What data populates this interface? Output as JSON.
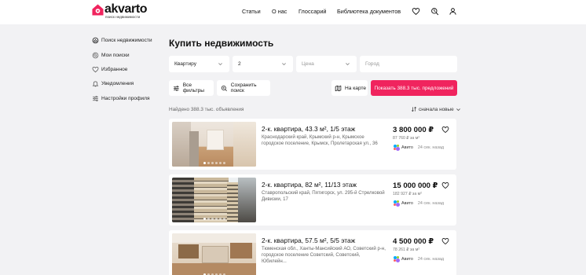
{
  "brand": {
    "name": "akvarto",
    "tagline": "поиск недвижимости",
    "accent": "#f0245e"
  },
  "nav": [
    "Статьи",
    "О нас",
    "Глоссарий",
    "Библиотека документов"
  ],
  "header_icons": [
    "heart-icon",
    "search-history-icon",
    "user-icon"
  ],
  "sidebar": [
    {
      "label": "Поиск недвижимости",
      "icon": "search-home-icon"
    },
    {
      "label": "Мои поиски",
      "icon": "search-icon"
    },
    {
      "label": "Избранное",
      "icon": "heart-icon"
    },
    {
      "label": "Уведомления",
      "icon": "bell-icon"
    },
    {
      "label": "Настройки профиля",
      "icon": "settings-icon"
    }
  ],
  "main": {
    "title": "Купить недвижимость",
    "filters": {
      "type": "Квартиру",
      "rooms": "2",
      "price_placeholder": "Цена",
      "city_placeholder": "Город"
    },
    "buttons": {
      "all_filters": "Все фильтры",
      "save_search": "Сохранить поиск",
      "on_map": "На карте",
      "show": "Показать 388.3 тыс. предложений"
    },
    "found": "Найдено 388.3 тыс. объявления",
    "sort": "сначала новые"
  },
  "listings": [
    {
      "title": "2-к. квартира, 43.3 м², 1/5 этаж",
      "address": "Краснодарский край, Крымский р-н, Крымское городское поселение, Крымск, Пролетарская ул., 36",
      "price": "3 800 000 ₽",
      "price_per_m2": "87 760 ₽ за м²",
      "source": "Авито",
      "ago": "24 сек. назад"
    },
    {
      "title": "2-к. квартира, 82 м², 11/13 этаж",
      "address": "Ставропольский край, Пятигорск, ул. 295-й Стрелковой Дивизии, 17",
      "price": "15 000 000 ₽",
      "price_per_m2": "182 927 ₽ за м²",
      "source": "Авито",
      "ago": "24 сек. назад"
    },
    {
      "title": "2-к. квартира, 57.5 м², 5/5 этаж",
      "address": "Тюменская обл., Ханты-Мансийский АО, Советский р-н, городское поселение Советский, Советский, Юбилейн...",
      "price": "4 500 000 ₽",
      "price_per_m2": "78 261 ₽ за м²",
      "source": "Авито",
      "ago": "24 сек. назад"
    }
  ]
}
